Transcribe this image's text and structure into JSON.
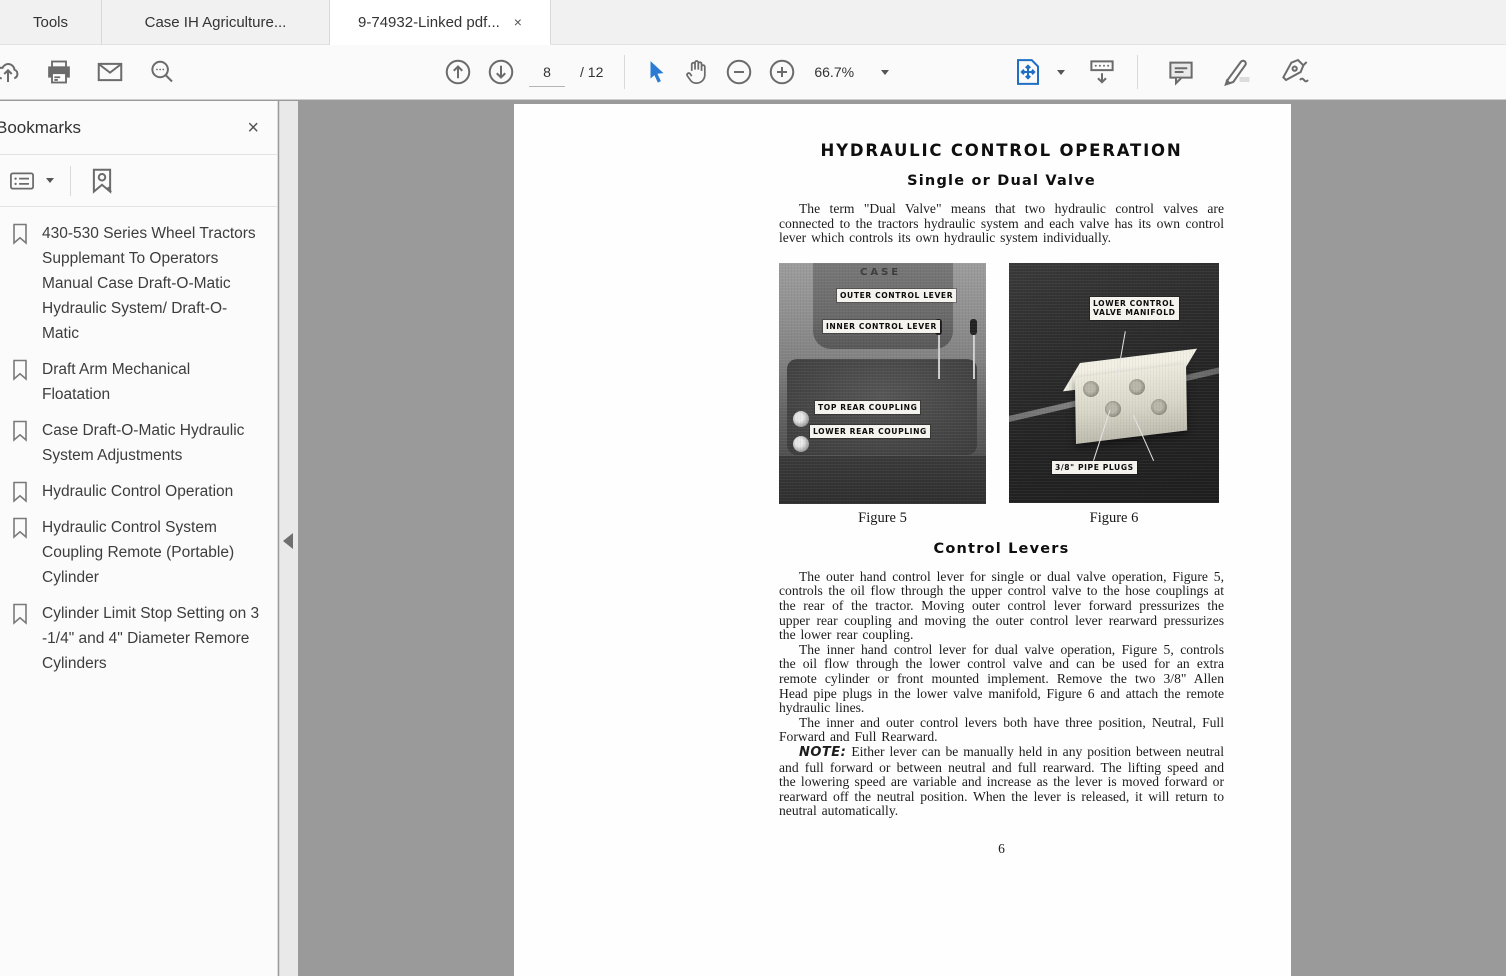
{
  "tabs": {
    "tools": "Tools",
    "doc1": "Case IH Agriculture...",
    "doc2": "9-74932-Linked pdf...",
    "close_glyph": "×"
  },
  "toolbar": {
    "page_current": "8",
    "page_total": "/ 12",
    "zoom_level": "66.7%"
  },
  "bookmarks": {
    "title": "Bookmarks",
    "close_glyph": "×",
    "items": [
      {
        "label": "430-530 Series Wheel Tractors Supplemant To Operators Manual Case Draft-O-Matic Hydraulic System/ Draft-O-Matic"
      },
      {
        "label": "Draft Arm Mechanical Floatation"
      },
      {
        "label": "Case Draft-O-Matic Hydraulic System Adjustments"
      },
      {
        "label": "Hydraulic Control Operation"
      },
      {
        "label": "Hydraulic Control System Coupling Remote (Portable) Cylinder"
      },
      {
        "label": "Cylinder Limit Stop Setting on 3 -1/4\" and 4\" Diameter Remore Cylinders"
      }
    ]
  },
  "document": {
    "title": "HYDRAULIC CONTROL OPERATION",
    "subtitle": "Single or Dual Valve",
    "intro": "The term \"Dual Valve\" means that two hydraulic control valves are connected to the tractors hydraulic system and each valve has its own control lever which controls its own hydraulic system individually.",
    "figure5": {
      "brand": "CASE",
      "labels": [
        "OUTER CONTROL LEVER",
        "INNER CONTROL LEVER",
        "TOP REAR COUPLING",
        "LOWER REAR COUPLING"
      ],
      "caption": "Figure 5"
    },
    "figure6": {
      "label_manifold": "LOWER CONTROL\nVALVE MANIFOLD",
      "label_plugs": "3/8\" PIPE PLUGS",
      "caption": "Figure 6"
    },
    "section_heading": "Control Levers",
    "para1": "The outer hand control lever for single or dual valve operation, Figure 5, controls the oil flow through the upper control valve to the hose couplings at the rear of the tractor. Moving outer control lever forward pressurizes the upper rear coupling and moving the outer control lever rearward pressurizes the lower rear coupling.",
    "para2": "The inner hand control lever for dual valve operation, Figure 5, controls the oil flow through the lower control valve and can be used for an extra remote cylinder or front mounted implement. Remove the two 3/8\" Allen Head pipe plugs in the lower valve manifold, Figure 6 and attach the remote hydraulic lines.",
    "para3": "The inner and outer control levers both have three position, Neutral, Full Forward and Full Rearward.",
    "note_label": "NOTE:",
    "note_text": " Either lever can be manually held in any position between neutral and full forward or between neutral and full rearward. The lifting speed and the lowering speed are variable and increase as the lever is moved forward or rearward off the neutral position. When the lever is released, it will return to neutral automatically.",
    "page_number": "6"
  }
}
